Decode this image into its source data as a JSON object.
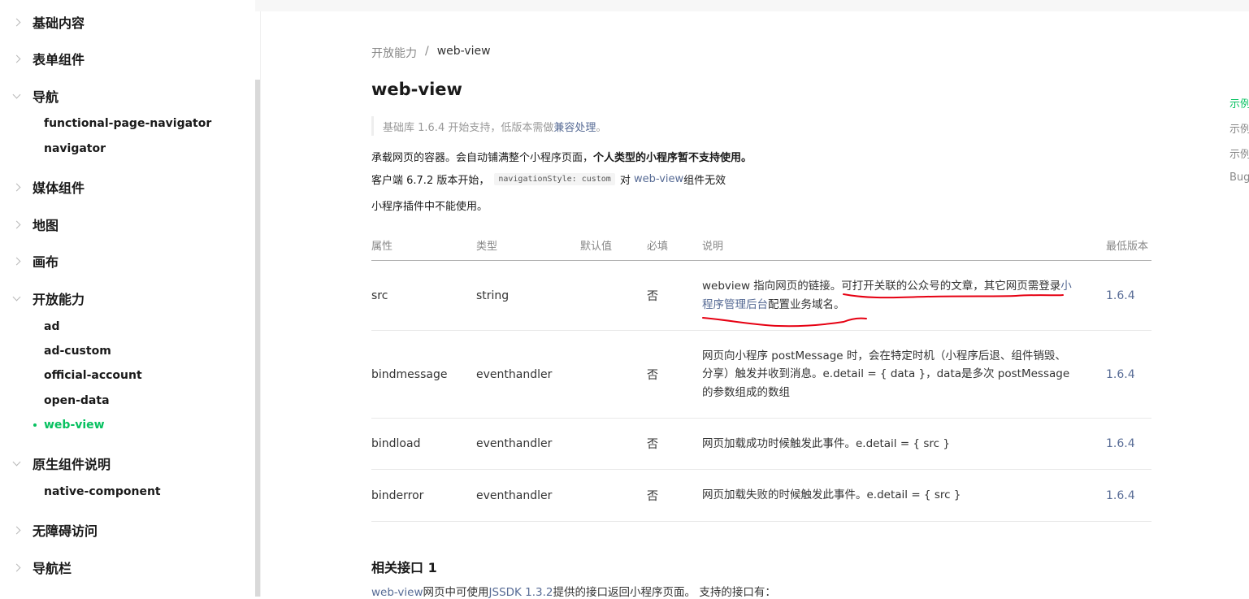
{
  "sidebar": {
    "groups": [
      {
        "label": "基础内容"
      },
      {
        "label": "表单组件"
      },
      {
        "label": "导航"
      },
      {
        "label": "媒体组件"
      },
      {
        "label": "地图"
      },
      {
        "label": "画布"
      },
      {
        "label": "开放能力"
      },
      {
        "label": "原生组件说明"
      },
      {
        "label": "无障碍访问"
      },
      {
        "label": "导航栏"
      }
    ],
    "nav_items": [
      "functional-page-navigator",
      "navigator"
    ],
    "open_items": [
      "ad",
      "ad-custom",
      "official-account",
      "open-data",
      "web-view"
    ],
    "native_items": [
      "native-component"
    ]
  },
  "breadcrumb": {
    "parent": "开放能力",
    "separator": "/",
    "current": "web-view"
  },
  "title": "web-view",
  "note": {
    "prefix": "基础库 1.6.4 开始支持，低版本需做",
    "link": "兼容处理",
    "suffix": "。"
  },
  "intro": {
    "line1_normal": "承载网页的容器。会自动铺满整个小程序页面，",
    "line1_bold": "个人类型的小程序暂不支持使用。",
    "line2_prefix": "客户端 6.7.2 版本开始，",
    "line2_code": "navigationStyle: custom",
    "line2_mid": " 对 ",
    "line2_link": "web-view",
    "line2_suffix": " 组件无效",
    "line3": "小程序插件中不能使用。"
  },
  "table": {
    "headers": {
      "attr": "属性",
      "type": "类型",
      "default": "默认值",
      "required": "必填",
      "desc": "说明",
      "version": "最低版本"
    },
    "rows": [
      {
        "attr": "src",
        "type": "string",
        "default": "",
        "required": "否",
        "desc_a": "webview 指向网页的链接。可打开关联的公众号的文章，其它网页需登录",
        "desc_link": "小程序管理后台",
        "desc_b": "配置业务域名。",
        "version": "1.6.4"
      },
      {
        "attr": "bindmessage",
        "type": "eventhandler",
        "default": "",
        "required": "否",
        "desc": "网页向小程序 postMessage 时，会在特定时机（小程序后退、组件销毁、分享）触发并收到消息。e.detail = { data }，data是多次 postMessage 的参数组成的数组",
        "version": "1.6.4"
      },
      {
        "attr": "bindload",
        "type": "eventhandler",
        "default": "",
        "required": "否",
        "desc": "网页加载成功时候触发此事件。e.detail = { src }",
        "version": "1.6.4"
      },
      {
        "attr": "binderror",
        "type": "eventhandler",
        "default": "",
        "required": "否",
        "desc": "网页加载失败的时候触发此事件。e.detail = { src }",
        "version": "1.6.4"
      }
    ]
  },
  "related": {
    "title": "相关接口 1",
    "link1": "web-view",
    "text1": "网页中可使用",
    "link2": "JSSDK 1.3.2",
    "text2": "提供的接口返回小程序页面。 支持的接口有："
  },
  "toc": [
    "示例",
    "示例",
    "示例",
    "Bug"
  ],
  "colors": {
    "accent": "#07c160",
    "link": "#576b95",
    "annotation": "#e60012"
  }
}
